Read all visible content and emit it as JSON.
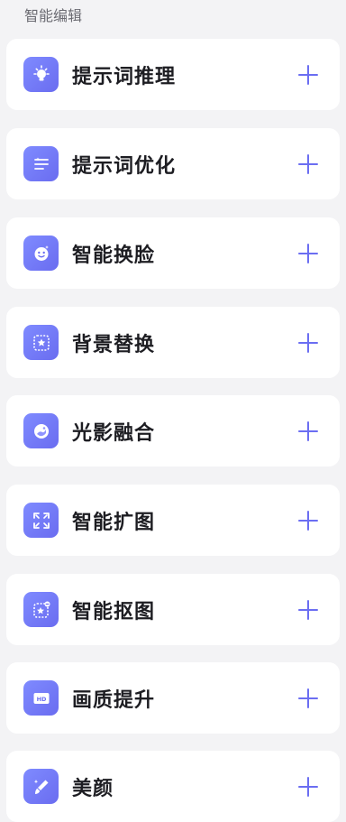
{
  "section": {
    "title": "智能编辑"
  },
  "colors": {
    "accent": "#6b6ef2",
    "card": "#ffffff",
    "background": "#f3f3f5"
  },
  "items": [
    {
      "label": "提示词推理",
      "icon": "bulb-icon"
    },
    {
      "label": "提示词优化",
      "icon": "sliders-icon"
    },
    {
      "label": "智能换脸",
      "icon": "face-icon"
    },
    {
      "label": "背景替换",
      "icon": "background-star-icon"
    },
    {
      "label": "光影融合",
      "icon": "light-shadow-icon"
    },
    {
      "label": "智能扩图",
      "icon": "expand-icon"
    },
    {
      "label": "智能抠图",
      "icon": "cutout-icon"
    },
    {
      "label": "画质提升",
      "icon": "hd-icon"
    },
    {
      "label": "美颜",
      "icon": "beauty-brush-icon"
    }
  ]
}
